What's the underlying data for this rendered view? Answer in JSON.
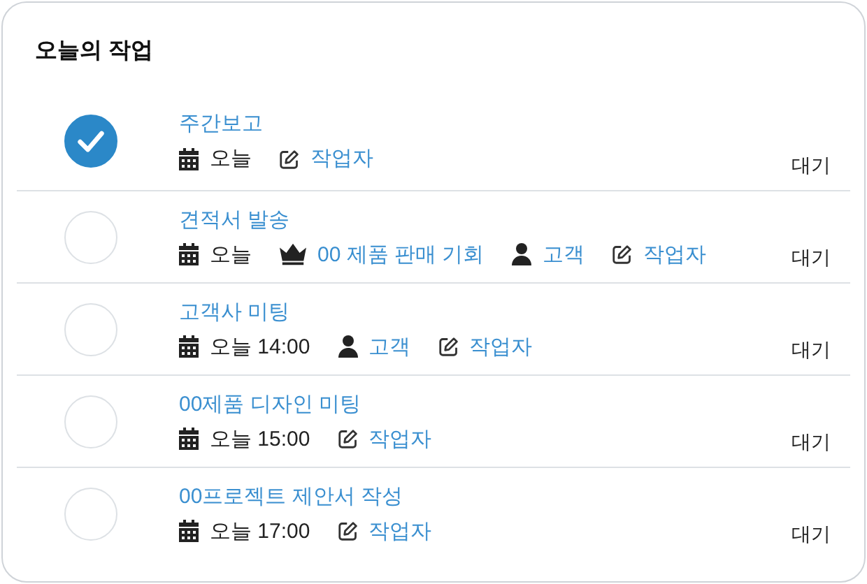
{
  "panel": {
    "title": "오늘의 작업"
  },
  "tasks": [
    {
      "title": "주간보고",
      "checked": true,
      "status": "대기",
      "meta": [
        {
          "kind": "date",
          "text": "오늘"
        },
        {
          "kind": "assignee",
          "text": "작업자"
        }
      ]
    },
    {
      "title": "견적서 발송",
      "checked": false,
      "status": "대기",
      "meta": [
        {
          "kind": "date",
          "text": "오늘"
        },
        {
          "kind": "deal",
          "text": "00 제품 판매 기회"
        },
        {
          "kind": "contact",
          "text": "고객"
        },
        {
          "kind": "assignee",
          "text": "작업자"
        }
      ]
    },
    {
      "title": "고객사 미팅",
      "checked": false,
      "status": "대기",
      "meta": [
        {
          "kind": "date",
          "text": "오늘 14:00"
        },
        {
          "kind": "contact",
          "text": "고객"
        },
        {
          "kind": "assignee",
          "text": "작업자"
        }
      ]
    },
    {
      "title": "00제품 디자인 미팅",
      "checked": false,
      "status": "대기",
      "meta": [
        {
          "kind": "date",
          "text": "오늘 15:00"
        },
        {
          "kind": "assignee",
          "text": "작업자"
        }
      ]
    },
    {
      "title": "00프로젝트 제안서 작성",
      "checked": false,
      "status": "대기",
      "meta": [
        {
          "kind": "date",
          "text": "오늘 17:00"
        },
        {
          "kind": "assignee",
          "text": "작업자"
        }
      ]
    }
  ]
}
